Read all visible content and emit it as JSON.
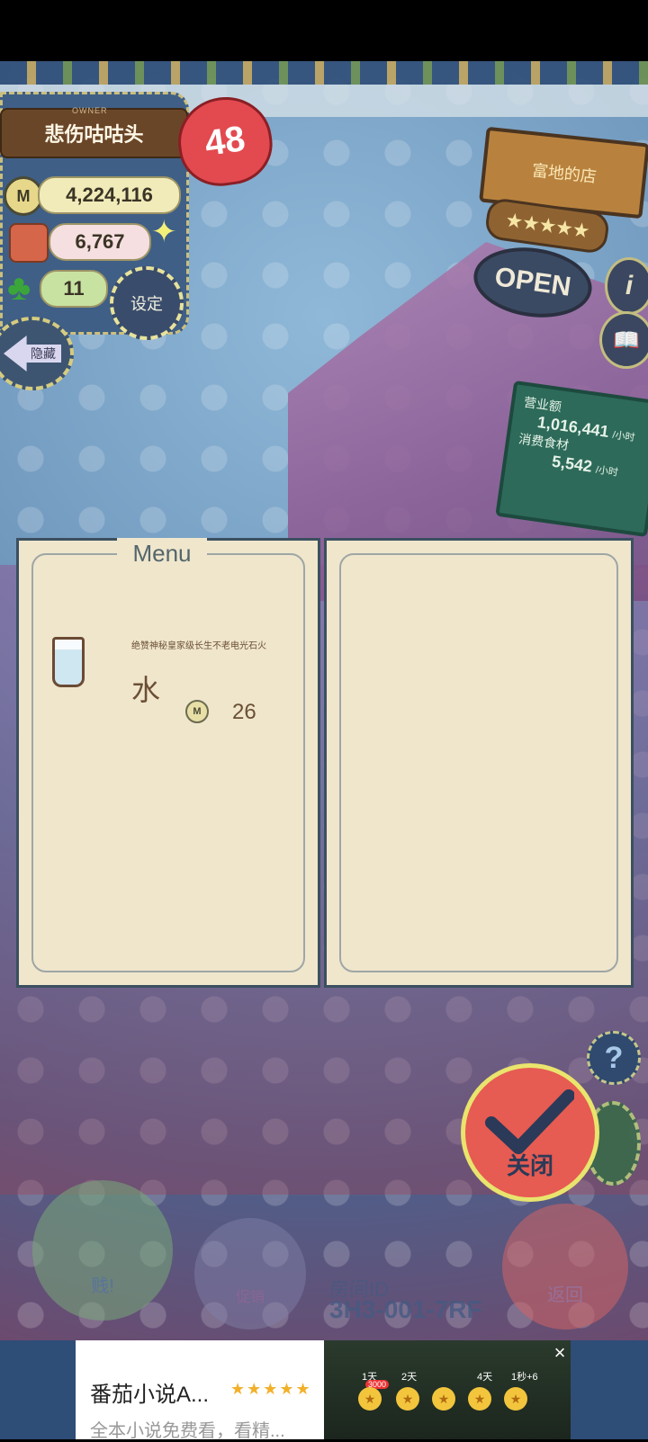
{
  "player": {
    "name": "悲伤咕咕头",
    "owner_label": "OWNER",
    "level": "48",
    "money": "4,224,116",
    "food": "6,767",
    "clover": "11"
  },
  "buttons": {
    "settings": "设定",
    "hide": "隐藏",
    "close": "关闭",
    "help": "?",
    "tips": "贱!",
    "promo": "促销",
    "return": "返回"
  },
  "shop": {
    "name": "富地的店",
    "stars": "★★★★★",
    "open": "OPEN",
    "info": "i"
  },
  "revenue": {
    "income_label": "营业额",
    "income_value": "1,016,441",
    "income_unit": "/小时",
    "food_label": "消费食材",
    "food_value": "5,542",
    "food_unit": "/小时"
  },
  "menu": {
    "title": "Menu",
    "items": [
      {
        "desc": "绝赞神秘皇家级长生不老电光石火",
        "name": "水",
        "price": "26",
        "icon": "water-glass-icon"
      }
    ]
  },
  "room": {
    "label": "房间ID",
    "id": "3H3-001-7RF"
  },
  "ad": {
    "title": "番茄小说A...",
    "stars": "★★★★★",
    "subtitle": "全本小说免费看，看精...",
    "days": [
      "1天",
      "2天",
      "4天",
      "1秒+6"
    ],
    "bonus": "3000"
  },
  "colors": {
    "close_button": "#e65b52",
    "menu_paper": "#efe6cc",
    "panel_blue": "#3f5f86"
  }
}
